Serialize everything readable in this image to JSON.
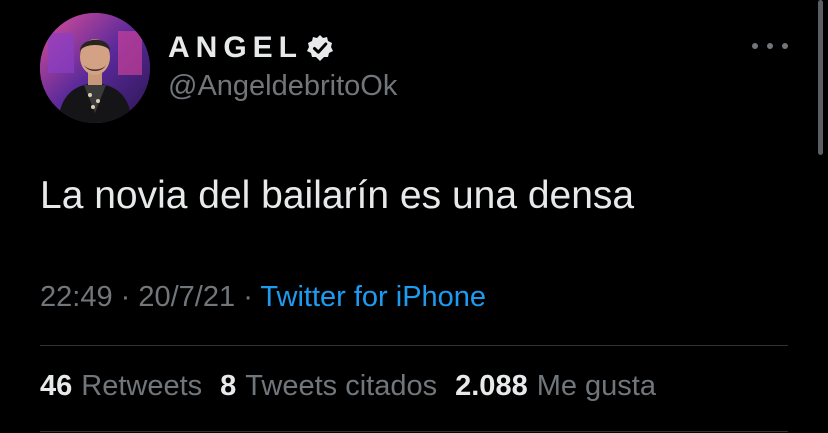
{
  "user": {
    "display_name": "ANGEL",
    "handle": "@AngeldebritoOk",
    "verified": true
  },
  "tweet": {
    "text": "La novia del bailarín es una densa",
    "time": "22:49",
    "separator": "·",
    "date": "20/7/21",
    "source": "Twitter for iPhone"
  },
  "stats": {
    "retweets_count": "46",
    "retweets_label": "Retweets",
    "quotes_count": "8",
    "quotes_label": "Tweets citados",
    "likes_count": "2.088",
    "likes_label": "Me gusta"
  },
  "colors": {
    "background": "#000000",
    "primary_text": "#e7e9ea",
    "secondary_text": "#71767b",
    "link": "#1d9bf0",
    "divider": "#2f3336"
  },
  "icons": {
    "verified": "verified-badge-icon",
    "more": "more-horizontal-icon"
  }
}
